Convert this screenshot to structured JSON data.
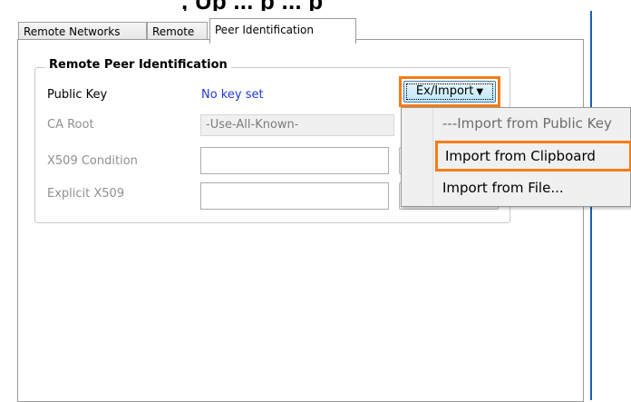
{
  "header_fragment": ", Up   ...   p   ...   p",
  "tabs": [
    {
      "label": "Remote Networks"
    },
    {
      "label": "Remote"
    },
    {
      "label": "Peer Identification"
    }
  ],
  "group": {
    "title": "Remote Peer Identification"
  },
  "fields": {
    "public_key_label": "Public Key",
    "public_key_value": "No key set",
    "ca_root_label": "CA Root",
    "ca_root_value": "-Use-All-Known-",
    "x509_condition_label": "X509 Condition",
    "explicit_x509_label": "Explicit X509"
  },
  "ex_import": {
    "label": "Ex/Import",
    "caret": "▼"
  },
  "menu": {
    "items": [
      {
        "label": "---Import from Public Key",
        "state": "disabled"
      },
      {
        "label": "Import from Clipboard",
        "state": "highlighted"
      },
      {
        "label": "Import from File...",
        "state": "normal"
      }
    ]
  },
  "colors": {
    "highlight": "#f57d14",
    "link": "#1f3bd4",
    "edge": "#1d5fb5"
  }
}
